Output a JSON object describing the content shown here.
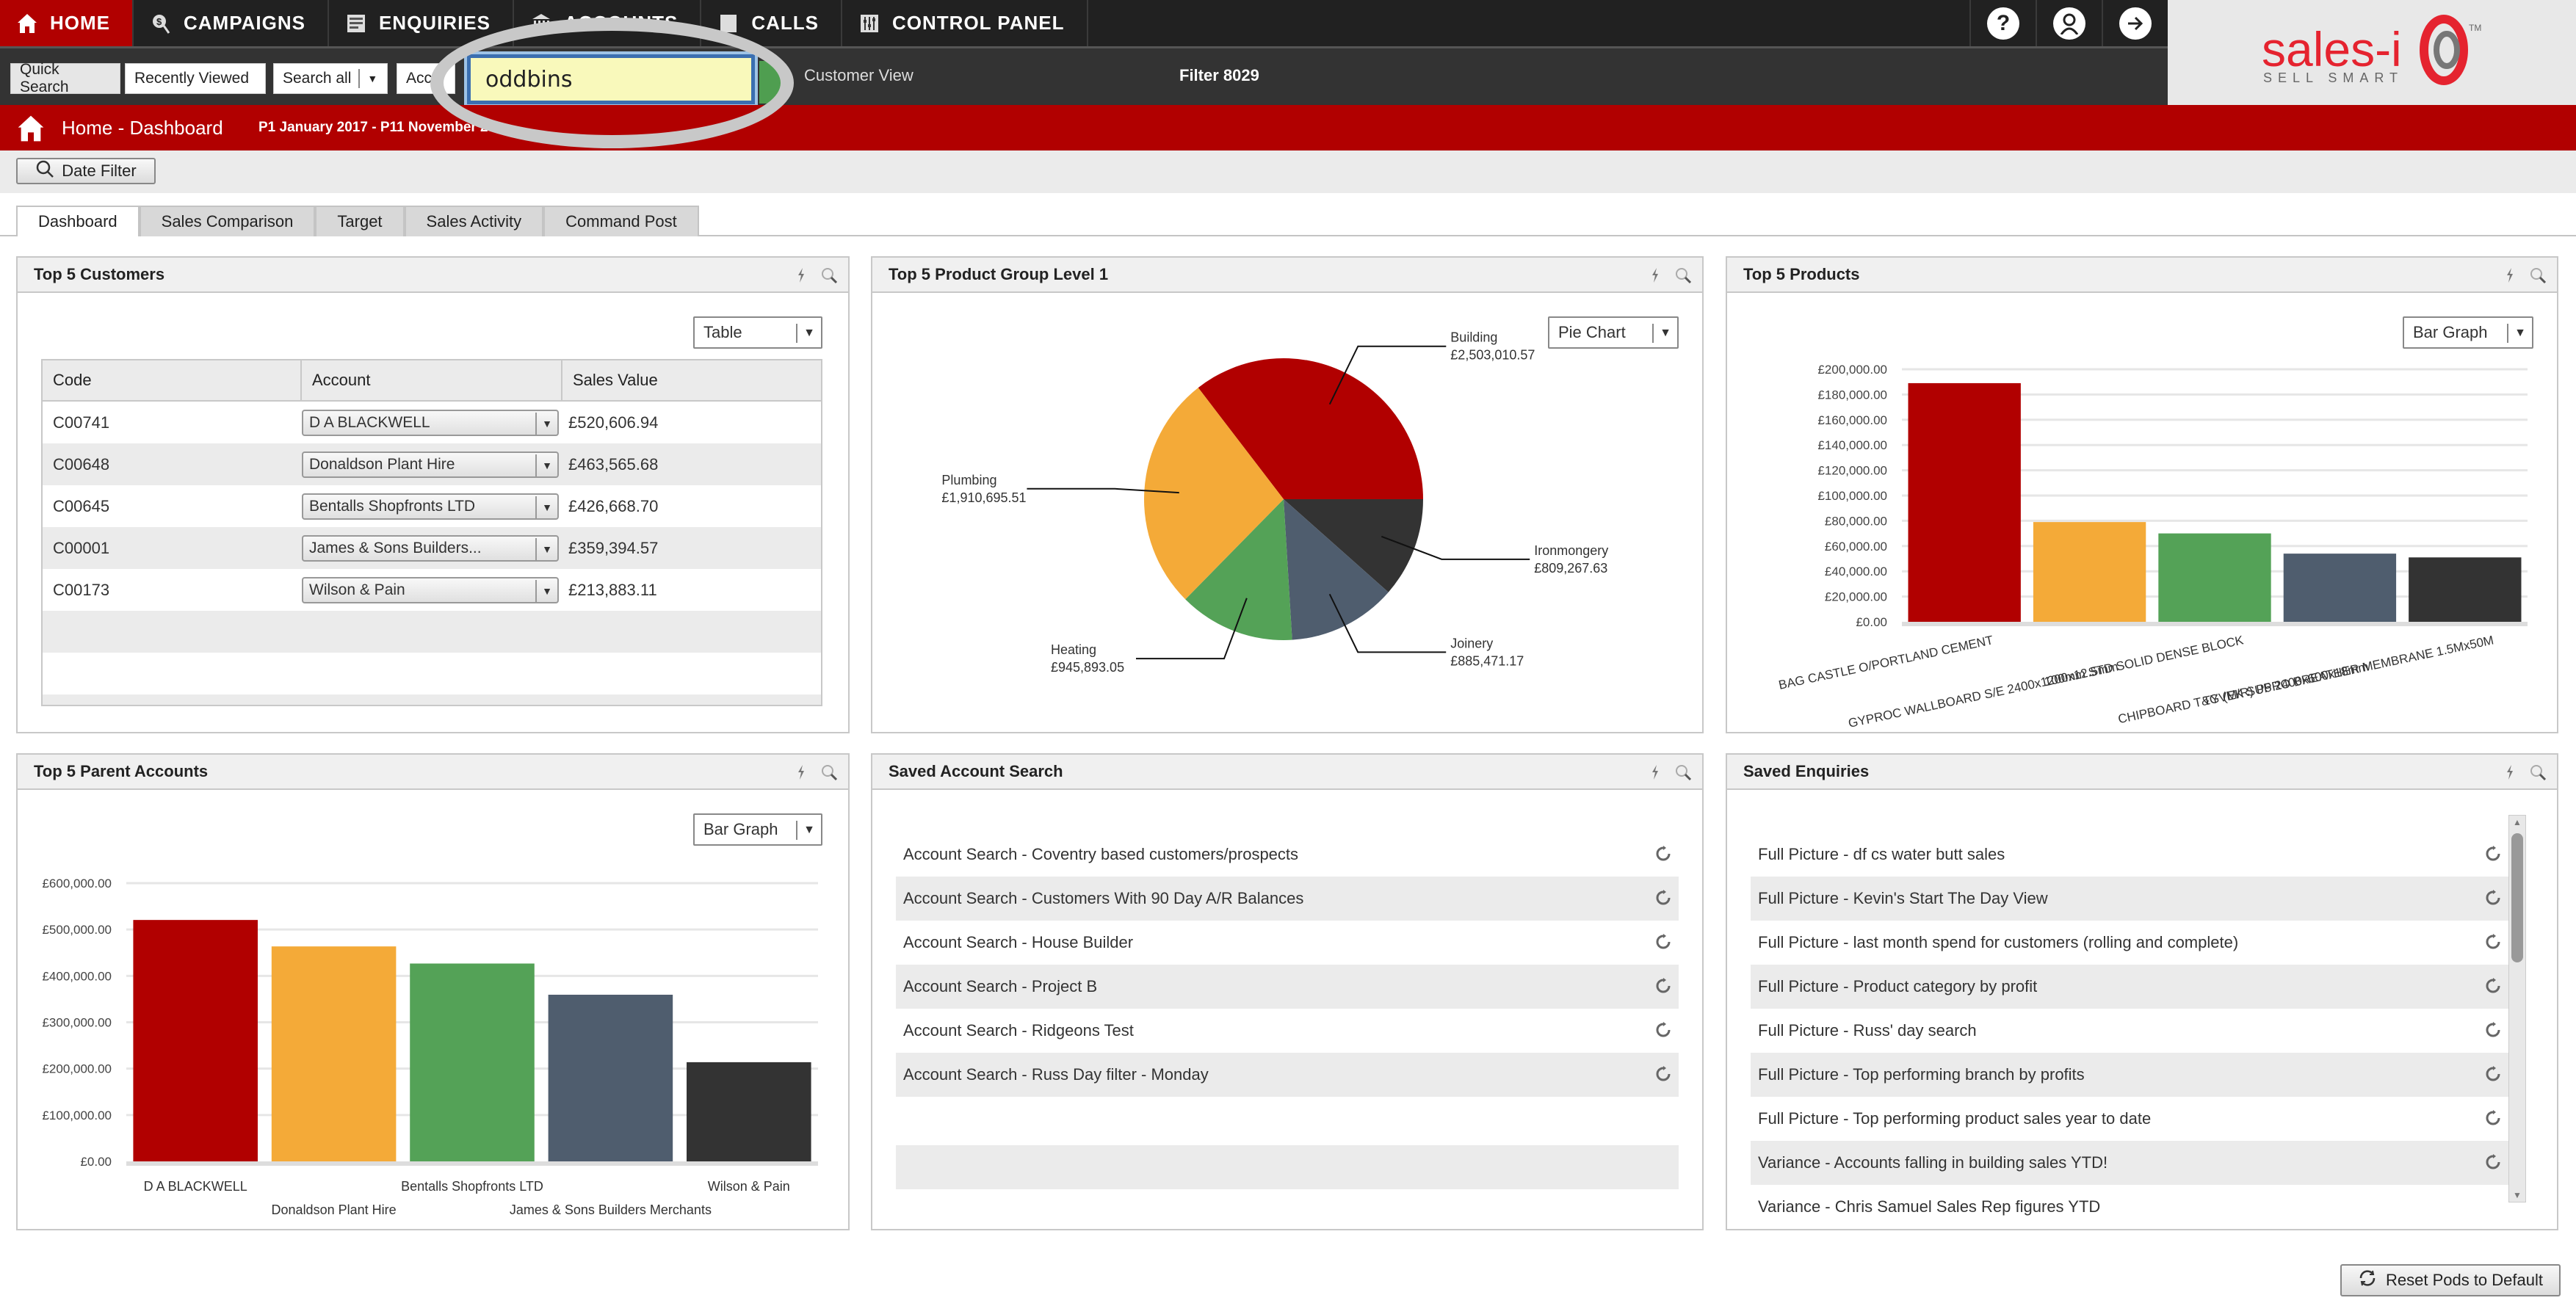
{
  "nav": {
    "items": [
      {
        "label": "HOME",
        "icon": "home-icon",
        "active": true
      },
      {
        "label": "CAMPAIGNS",
        "icon": "campaigns-icon",
        "active": false
      },
      {
        "label": "ENQUIRIES",
        "icon": "enquiries-icon",
        "active": false
      },
      {
        "label": "ACCOUNTS",
        "icon": "accounts-icon",
        "active": false
      },
      {
        "label": "CALLS",
        "icon": "calls-icon",
        "active": false
      },
      {
        "label": "CONTROL PANEL",
        "icon": "control-panel-icon",
        "active": false
      }
    ],
    "right_icons": [
      "help-icon",
      "user-icon",
      "logout-icon"
    ]
  },
  "toolbar": {
    "quick_search": "Quick Search",
    "recently_viewed": "Recently Viewed",
    "search_scope": "Search all",
    "search_type": "Acc",
    "search_value": "oddbins",
    "customer_view": "Customer View",
    "filter": "Filter 8029"
  },
  "logo": {
    "text": "sales-i",
    "tagline": "SELL SMART",
    "tm": "TM"
  },
  "breadcrumb": {
    "title": "Home - Dashboard",
    "date_range": "P1 January 2017 - P11 November 20"
  },
  "date_filter_label": "Date Filter",
  "tabs": [
    {
      "label": "Dashboard",
      "active": true
    },
    {
      "label": "Sales Comparison",
      "active": false
    },
    {
      "label": "Target",
      "active": false
    },
    {
      "label": "Sales Activity",
      "active": false
    },
    {
      "label": "Command Post",
      "active": false
    }
  ],
  "colors": {
    "brand_red": "#b10000",
    "series": [
      "#b10000",
      "#f4aa38",
      "#54a257",
      "#4f5d6e",
      "#333333"
    ]
  },
  "pods": {
    "top_customers": {
      "title": "Top 5 Customers",
      "view": "Table",
      "columns": [
        "Code",
        "Account",
        "Sales Value"
      ],
      "rows": [
        {
          "code": "C00741",
          "account": "D A BLACKWELL",
          "value": "£520,606.94"
        },
        {
          "code": "C00648",
          "account": "Donaldson Plant Hire",
          "value": "£463,565.68"
        },
        {
          "code": "C00645",
          "account": "Bentalls Shopfronts LTD",
          "value": "£426,668.70"
        },
        {
          "code": "C00001",
          "account": "James & Sons Builders...",
          "value": "£359,394.57"
        },
        {
          "code": "C00173",
          "account": "Wilson & Pain",
          "value": "£213,883.11"
        }
      ]
    },
    "product_group": {
      "title": "Top 5 Product Group Level 1",
      "view": "Pie Chart"
    },
    "top_products": {
      "title": "Top 5 Products",
      "view": "Bar Graph"
    },
    "parent_accounts": {
      "title": "Top 5 Parent Accounts",
      "view": "Bar Graph"
    },
    "saved_account_search": {
      "title": "Saved Account Search",
      "items": [
        "Account Search - Coventry based customers/prospects",
        "Account Search - Customers With 90 Day A/R Balances",
        "Account Search - House Builder",
        "Account Search - Project B",
        "Account Search - Ridgeons Test",
        "Account Search - Russ Day filter - Monday"
      ]
    },
    "saved_enquiries": {
      "title": "Saved Enquiries",
      "items": [
        "Full Picture - df cs water butt sales",
        "Full Picture - Kevin's Start The Day View",
        "Full Picture - last month spend for customers (rolling and complete)",
        "Full Picture - Product category by profit",
        "Full Picture - Russ' day search",
        "Full Picture - Top performing branch by profits",
        "Full Picture - Top performing product sales year to date",
        "Variance - Accounts falling in building sales YTD!",
        "Variance - Chris Samuel Sales Rep figures YTD"
      ]
    }
  },
  "reset_button": "Reset Pods to Default",
  "chart_data": [
    {
      "id": "product_group",
      "type": "pie",
      "title": "Top 5 Product Group Level 1",
      "categories": [
        "Building",
        "Ironmongery",
        "Joinery",
        "Heating",
        "Plumbing"
      ],
      "values": [
        2503010.57,
        809267.63,
        885471.17,
        945893.05,
        1910695.51
      ],
      "labels": [
        "£2,503,010.57",
        "£809,267.63",
        "£885,471.17",
        "£945,893.05",
        "£1,910,695.51"
      ]
    },
    {
      "id": "top_products",
      "type": "bar",
      "title": "Top 5 Products",
      "categories": [
        "BAG CASTLE O/PORTLAND CEMENT",
        "GYPROC WALLBOARD S/E 2400x1200x12.5mm",
        "100mm STD SOLID DENSE BLOCK",
        "CHIPBOARD T&G (M/R) P5 2400x600x18mm",
        "TYVEK SUPRO BREATHER MEMBRANE 1.5Mx50M"
      ],
      "values": [
        189000,
        79000,
        70000,
        54000,
        51000
      ],
      "ylim": [
        0,
        200000
      ],
      "yticks": [
        "£0.00",
        "£20,000.00",
        "£40,000.00",
        "£60,000.00",
        "£80,000.00",
        "£100,000.00",
        "£120,000.00",
        "£140,000.00",
        "£160,000.00",
        "£180,000.00",
        "£200,000.00"
      ],
      "grid": true
    },
    {
      "id": "parent_accounts",
      "type": "bar",
      "title": "Top 5 Parent Accounts",
      "categories": [
        "D A BLACKWELL",
        "Donaldson Plant Hire",
        "Bentalls Shopfronts LTD",
        "James & Sons Builders Merchants",
        "Wilson & Pain"
      ],
      "values": [
        520606.94,
        463565.68,
        426668.7,
        359394.57,
        213883.11
      ],
      "ylim": [
        0,
        600000
      ],
      "yticks": [
        "£0.00",
        "£100,000.00",
        "£200,000.00",
        "£300,000.00",
        "£400,000.00",
        "£500,000.00",
        "£600,000.00"
      ],
      "grid": true
    }
  ]
}
